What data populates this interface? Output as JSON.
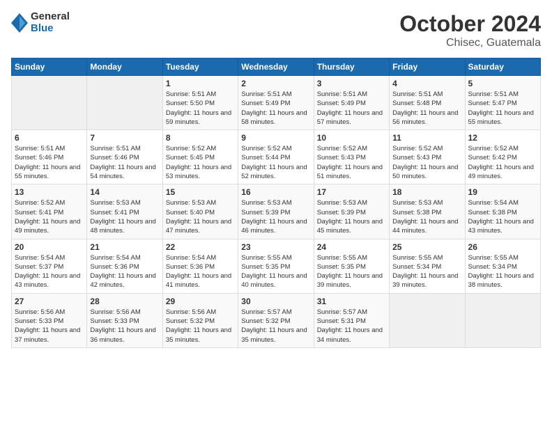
{
  "logo": {
    "general": "General",
    "blue": "Blue"
  },
  "header": {
    "month_year": "October 2024",
    "location": "Chisec, Guatemala"
  },
  "weekdays": [
    "Sunday",
    "Monday",
    "Tuesday",
    "Wednesday",
    "Thursday",
    "Friday",
    "Saturday"
  ],
  "weeks": [
    [
      {
        "day": "",
        "sunrise": "",
        "sunset": "",
        "daylight": ""
      },
      {
        "day": "",
        "sunrise": "",
        "sunset": "",
        "daylight": ""
      },
      {
        "day": "1",
        "sunrise": "Sunrise: 5:51 AM",
        "sunset": "Sunset: 5:50 PM",
        "daylight": "Daylight: 11 hours and 59 minutes."
      },
      {
        "day": "2",
        "sunrise": "Sunrise: 5:51 AM",
        "sunset": "Sunset: 5:49 PM",
        "daylight": "Daylight: 11 hours and 58 minutes."
      },
      {
        "day": "3",
        "sunrise": "Sunrise: 5:51 AM",
        "sunset": "Sunset: 5:49 PM",
        "daylight": "Daylight: 11 hours and 57 minutes."
      },
      {
        "day": "4",
        "sunrise": "Sunrise: 5:51 AM",
        "sunset": "Sunset: 5:48 PM",
        "daylight": "Daylight: 11 hours and 56 minutes."
      },
      {
        "day": "5",
        "sunrise": "Sunrise: 5:51 AM",
        "sunset": "Sunset: 5:47 PM",
        "daylight": "Daylight: 11 hours and 55 minutes."
      }
    ],
    [
      {
        "day": "6",
        "sunrise": "Sunrise: 5:51 AM",
        "sunset": "Sunset: 5:46 PM",
        "daylight": "Daylight: 11 hours and 55 minutes."
      },
      {
        "day": "7",
        "sunrise": "Sunrise: 5:51 AM",
        "sunset": "Sunset: 5:46 PM",
        "daylight": "Daylight: 11 hours and 54 minutes."
      },
      {
        "day": "8",
        "sunrise": "Sunrise: 5:52 AM",
        "sunset": "Sunset: 5:45 PM",
        "daylight": "Daylight: 11 hours and 53 minutes."
      },
      {
        "day": "9",
        "sunrise": "Sunrise: 5:52 AM",
        "sunset": "Sunset: 5:44 PM",
        "daylight": "Daylight: 11 hours and 52 minutes."
      },
      {
        "day": "10",
        "sunrise": "Sunrise: 5:52 AM",
        "sunset": "Sunset: 5:43 PM",
        "daylight": "Daylight: 11 hours and 51 minutes."
      },
      {
        "day": "11",
        "sunrise": "Sunrise: 5:52 AM",
        "sunset": "Sunset: 5:43 PM",
        "daylight": "Daylight: 11 hours and 50 minutes."
      },
      {
        "day": "12",
        "sunrise": "Sunrise: 5:52 AM",
        "sunset": "Sunset: 5:42 PM",
        "daylight": "Daylight: 11 hours and 49 minutes."
      }
    ],
    [
      {
        "day": "13",
        "sunrise": "Sunrise: 5:52 AM",
        "sunset": "Sunset: 5:41 PM",
        "daylight": "Daylight: 11 hours and 49 minutes."
      },
      {
        "day": "14",
        "sunrise": "Sunrise: 5:53 AM",
        "sunset": "Sunset: 5:41 PM",
        "daylight": "Daylight: 11 hours and 48 minutes."
      },
      {
        "day": "15",
        "sunrise": "Sunrise: 5:53 AM",
        "sunset": "Sunset: 5:40 PM",
        "daylight": "Daylight: 11 hours and 47 minutes."
      },
      {
        "day": "16",
        "sunrise": "Sunrise: 5:53 AM",
        "sunset": "Sunset: 5:39 PM",
        "daylight": "Daylight: 11 hours and 46 minutes."
      },
      {
        "day": "17",
        "sunrise": "Sunrise: 5:53 AM",
        "sunset": "Sunset: 5:39 PM",
        "daylight": "Daylight: 11 hours and 45 minutes."
      },
      {
        "day": "18",
        "sunrise": "Sunrise: 5:53 AM",
        "sunset": "Sunset: 5:38 PM",
        "daylight": "Daylight: 11 hours and 44 minutes."
      },
      {
        "day": "19",
        "sunrise": "Sunrise: 5:54 AM",
        "sunset": "Sunset: 5:38 PM",
        "daylight": "Daylight: 11 hours and 43 minutes."
      }
    ],
    [
      {
        "day": "20",
        "sunrise": "Sunrise: 5:54 AM",
        "sunset": "Sunset: 5:37 PM",
        "daylight": "Daylight: 11 hours and 43 minutes."
      },
      {
        "day": "21",
        "sunrise": "Sunrise: 5:54 AM",
        "sunset": "Sunset: 5:36 PM",
        "daylight": "Daylight: 11 hours and 42 minutes."
      },
      {
        "day": "22",
        "sunrise": "Sunrise: 5:54 AM",
        "sunset": "Sunset: 5:36 PM",
        "daylight": "Daylight: 11 hours and 41 minutes."
      },
      {
        "day": "23",
        "sunrise": "Sunrise: 5:55 AM",
        "sunset": "Sunset: 5:35 PM",
        "daylight": "Daylight: 11 hours and 40 minutes."
      },
      {
        "day": "24",
        "sunrise": "Sunrise: 5:55 AM",
        "sunset": "Sunset: 5:35 PM",
        "daylight": "Daylight: 11 hours and 39 minutes."
      },
      {
        "day": "25",
        "sunrise": "Sunrise: 5:55 AM",
        "sunset": "Sunset: 5:34 PM",
        "daylight": "Daylight: 11 hours and 39 minutes."
      },
      {
        "day": "26",
        "sunrise": "Sunrise: 5:55 AM",
        "sunset": "Sunset: 5:34 PM",
        "daylight": "Daylight: 11 hours and 38 minutes."
      }
    ],
    [
      {
        "day": "27",
        "sunrise": "Sunrise: 5:56 AM",
        "sunset": "Sunset: 5:33 PM",
        "daylight": "Daylight: 11 hours and 37 minutes."
      },
      {
        "day": "28",
        "sunrise": "Sunrise: 5:56 AM",
        "sunset": "Sunset: 5:33 PM",
        "daylight": "Daylight: 11 hours and 36 minutes."
      },
      {
        "day": "29",
        "sunrise": "Sunrise: 5:56 AM",
        "sunset": "Sunset: 5:32 PM",
        "daylight": "Daylight: 11 hours and 35 minutes."
      },
      {
        "day": "30",
        "sunrise": "Sunrise: 5:57 AM",
        "sunset": "Sunset: 5:32 PM",
        "daylight": "Daylight: 11 hours and 35 minutes."
      },
      {
        "day": "31",
        "sunrise": "Sunrise: 5:57 AM",
        "sunset": "Sunset: 5:31 PM",
        "daylight": "Daylight: 11 hours and 34 minutes."
      },
      {
        "day": "",
        "sunrise": "",
        "sunset": "",
        "daylight": ""
      },
      {
        "day": "",
        "sunrise": "",
        "sunset": "",
        "daylight": ""
      }
    ]
  ]
}
